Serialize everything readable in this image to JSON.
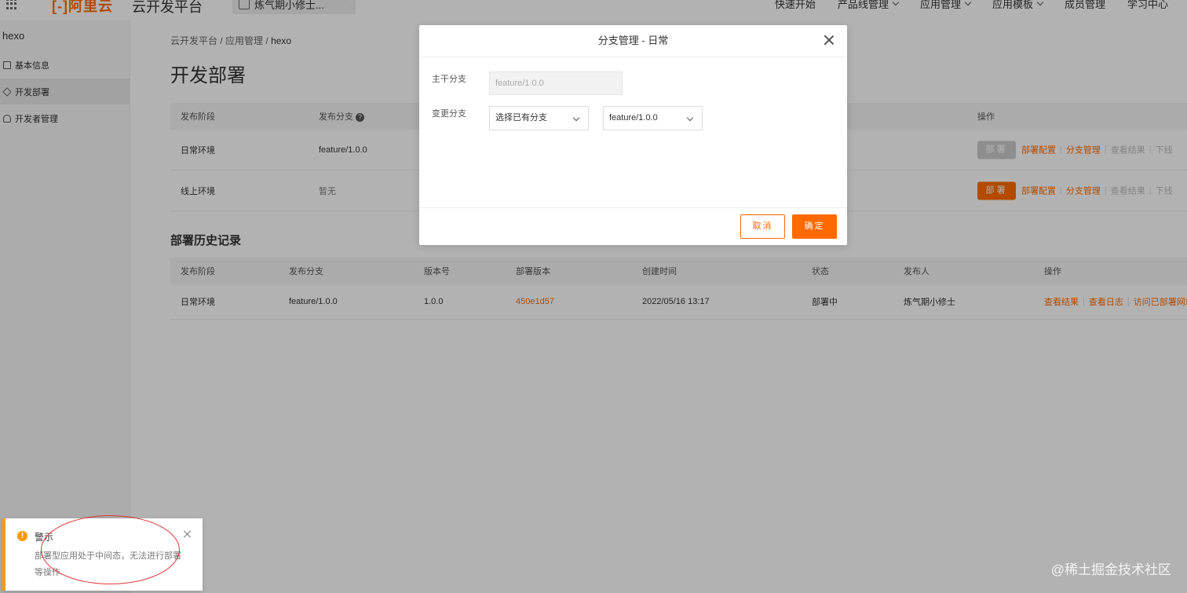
{
  "topbar": {
    "logo": "[-]阿里云",
    "platform": "云开发平台",
    "workspace": "炼气期小修士...",
    "nav": [
      "快速开始",
      "产品线管理",
      "应用管理",
      "应用模板",
      "成员管理",
      "学习中心"
    ]
  },
  "sidebar": {
    "app_name": "hexo",
    "items": [
      {
        "label": "基本信息",
        "icon": "document-icon"
      },
      {
        "label": "开发部署",
        "icon": "cube-icon",
        "active": true
      },
      {
        "label": "开发者管理",
        "icon": "user-icon"
      }
    ]
  },
  "breadcrumb": {
    "part1": "云开发平台",
    "sep": " / ",
    "part2": "应用管理",
    "current": "hexo"
  },
  "page_title": "开发部署",
  "deploy_table": {
    "headers": {
      "stage": "发布阶段",
      "branch": "发布分支",
      "ops": "操作"
    },
    "rows": [
      {
        "stage": "日常环境",
        "branch": "feature/1.0.0",
        "deploy": "部署",
        "config": "部署配置",
        "branch_mgmt": "分支管理",
        "result": "查看结果",
        "offline": "下线"
      },
      {
        "stage": "线上环境",
        "branch": "暂无",
        "deploy": "部署",
        "config": "部署配置",
        "branch_mgmt": "分支管理",
        "result": "查看结果",
        "offline": "下线"
      }
    ]
  },
  "history_title": "部署历史记录",
  "history_table": {
    "headers": [
      "发布阶段",
      "发布分支",
      "版本号",
      "部署版本",
      "创建时间",
      "状态",
      "发布人",
      "操作"
    ],
    "rows": [
      {
        "stage": "日常环境",
        "branch": "feature/1.0.0",
        "version": "1.0.0",
        "deploy_version": "450e1d57",
        "created": "2022/05/16 13:17",
        "status": "部署中",
        "publisher": "炼气期小修士",
        "view_result": "查看结果",
        "view_log": "查看日志",
        "visit": "访问已部署网站"
      }
    ]
  },
  "dialog": {
    "title": "分支管理 - 日常",
    "main_branch_label": "主干分支",
    "main_branch_value": "feature/1.0.0",
    "change_branch_label": "变更分支",
    "branch_mode": "选择已有分支",
    "branch_select": "feature/1.0.0",
    "cancel": "取消",
    "ok": "确定"
  },
  "toast": {
    "title": "警示",
    "message": "部署型应用处于中间态，无法进行部署等操作"
  },
  "watermark": "@稀土掘金技术社区",
  "colors": {
    "accent": "#ff6a00",
    "warning": "#ff9900",
    "annotation": "#d33333"
  }
}
